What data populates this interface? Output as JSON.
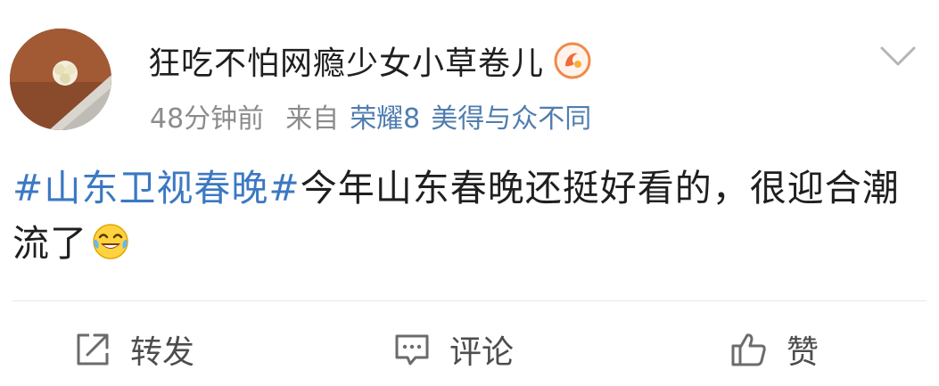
{
  "post": {
    "username": "狂吃不怕网瘾少女小草卷儿",
    "time": "48分钟前",
    "from_label": "来自",
    "device": "荣耀8",
    "slogan": "美得与众不同",
    "hashtag": "#山东卫视春晚#",
    "text": "今年山东春晚还挺好看的，很迎合潮流了",
    "icons": {
      "avatar": "avatar",
      "vip_badge": "vip-badge-icon",
      "more": "chevron-down-icon",
      "emoji": "laughing-tears-emoji"
    }
  },
  "actions": {
    "repost_label": "转发",
    "comment_label": "评论",
    "like_label": "赞"
  },
  "colors": {
    "link": "#507daf",
    "hashtag": "#3c78c3",
    "meta": "#8c8c8c",
    "text": "#1f1f1f",
    "action_text": "#4d4d4d"
  }
}
